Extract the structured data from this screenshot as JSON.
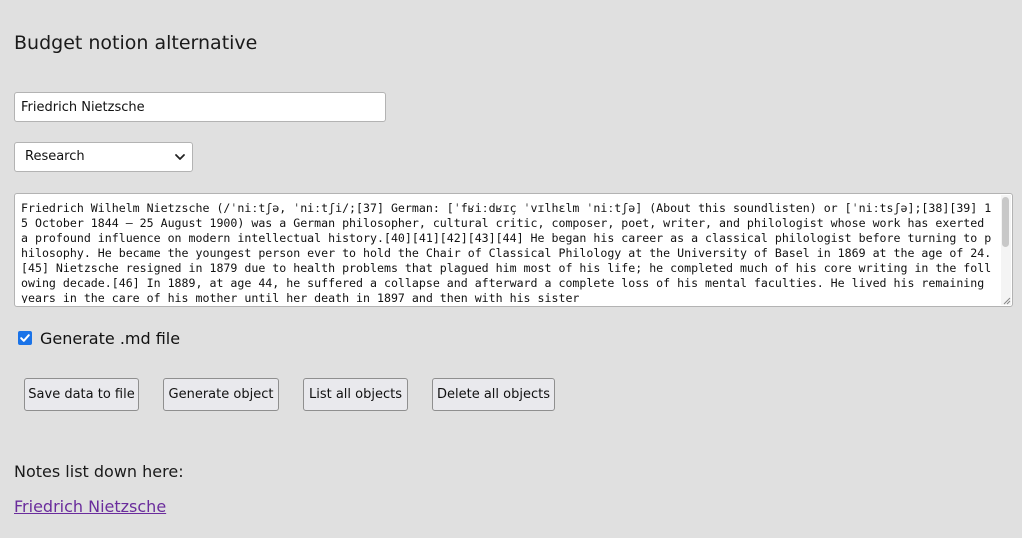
{
  "app": {
    "title": "Budget notion alternative"
  },
  "form": {
    "title_input_value": "Friedrich Nietzsche",
    "category_select": {
      "selected": "Research"
    },
    "body_text": "Friedrich Wilhelm Nietzsche (/ˈniːtʃə, ˈniːtʃi/;[37] German: [ˈfʁiːdʁɪç ˈvɪlhɛlm ˈniːtʃə] (About this soundlisten) or [ˈniːtsʃə];[38][39] 15 October 1844 – 25 August 1900) was a German philosopher, cultural critic, composer, poet, writer, and philologist whose work has exerted a profound influence on modern intellectual history.[40][41][42][43][44] He began his career as a classical philologist before turning to philosophy. He became the youngest person ever to hold the Chair of Classical Philology at the University of Basel in 1869 at the age of 24.[45] Nietzsche resigned in 1879 due to health problems that plagued him most of his life; he completed much of his core writing in the following decade.[46] In 1889, at age 44, he suffered a collapse and afterward a complete loss of his mental faculties. He lived his remaining years in the care of his mother until her death in 1897 and then with his sister",
    "generate_md_checkbox": {
      "label": "Generate .md file",
      "checked": true
    }
  },
  "actions": {
    "save_label": "Save data to file",
    "generate_label": "Generate object",
    "list_label": "List all objects",
    "delete_label": "Delete all objects"
  },
  "notes": {
    "heading": "Notes list down here:",
    "items": [
      {
        "label": "Friedrich Nietzsche"
      }
    ]
  },
  "colors": {
    "background": "#e0e0e0",
    "checkbox_accent": "#1a73e8",
    "link_visited": "#6a2c9c"
  }
}
